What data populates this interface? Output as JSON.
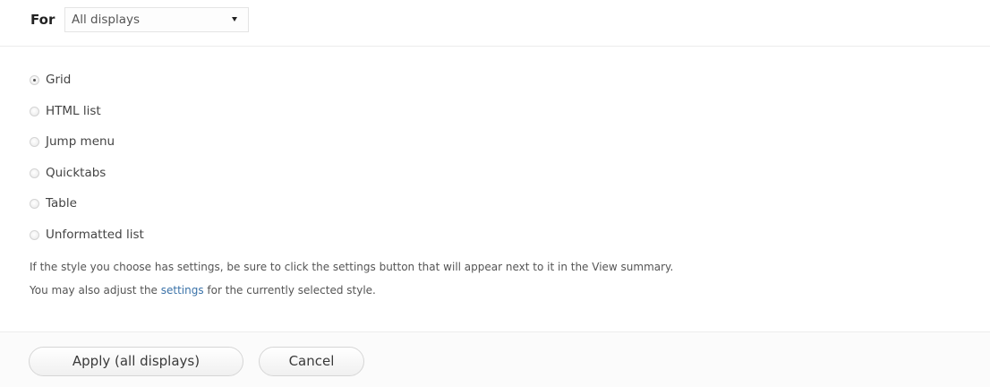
{
  "header": {
    "for_label": "For",
    "display_select": {
      "value": "All displays"
    }
  },
  "style_options": [
    {
      "label": "Grid",
      "checked": true
    },
    {
      "label": "HTML list",
      "checked": false
    },
    {
      "label": "Jump menu",
      "checked": false
    },
    {
      "label": "Quicktabs",
      "checked": false
    },
    {
      "label": "Table",
      "checked": false
    },
    {
      "label": "Unformatted list",
      "checked": false
    }
  ],
  "help": {
    "line1": "If the style you choose has settings, be sure to click the settings button that will appear next to it in the View summary.",
    "line2_before": "You may also adjust the ",
    "line2_link": "settings",
    "line2_after": " for the currently selected style."
  },
  "buttons": {
    "apply_label": "Apply (all displays)",
    "cancel_label": "Cancel"
  },
  "colors": {
    "link": "#3a72a8",
    "text": "#444444"
  }
}
